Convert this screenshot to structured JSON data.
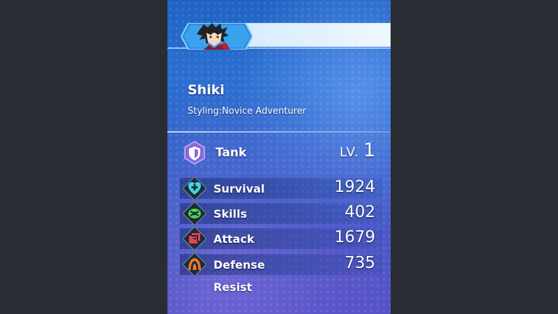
{
  "character": {
    "name": "Shiki",
    "styling": "Styling:Novice Adventurer"
  },
  "role": {
    "label": "Tank",
    "icon": "shield-icon",
    "level_prefix": "LV.",
    "level": "1"
  },
  "stats": [
    {
      "label": "Survival",
      "value": "1924",
      "icon": "heart-plus-icon",
      "color": "#3fd6e8"
    },
    {
      "label": "Skills",
      "value": "402",
      "icon": "skills-icon",
      "color": "#4fd84a"
    },
    {
      "label": "Attack",
      "value": "1679",
      "icon": "attack-icon",
      "color": "#e8424a"
    },
    {
      "label": "Defense",
      "value": "735",
      "icon": "defense-icon",
      "color": "#f07a1e"
    }
  ],
  "resist_label": "Resist",
  "colors": {
    "panel_blue": "#2b6fd0",
    "role_purple": "#8a6ad8",
    "header_bar": "#e4f1ff"
  }
}
